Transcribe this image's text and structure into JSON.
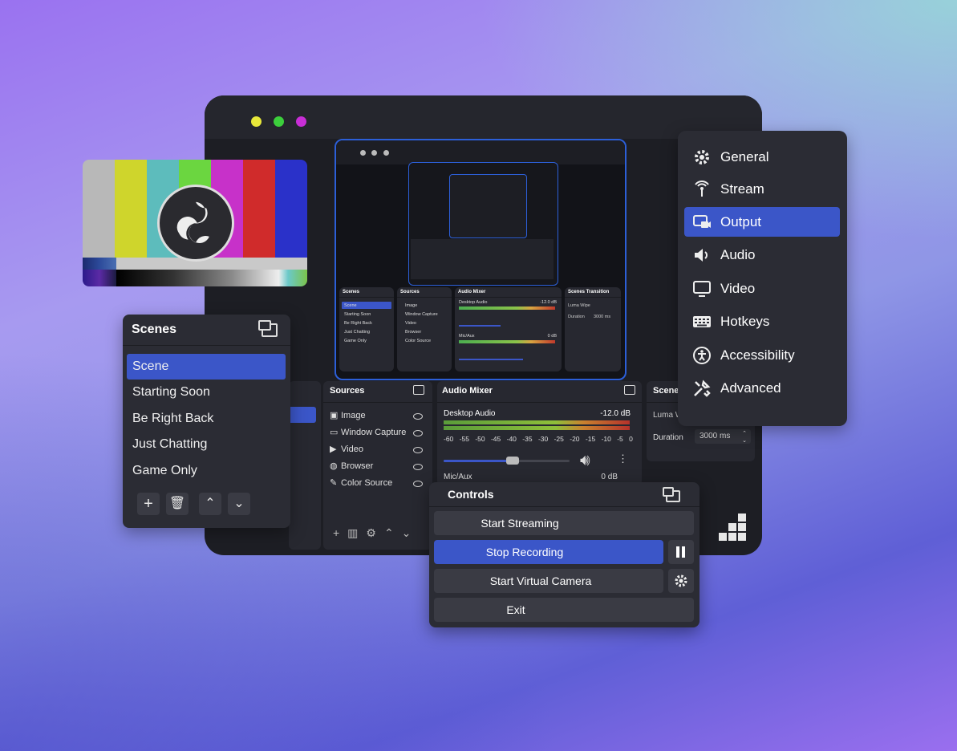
{
  "colors": {
    "accent": "#3b56c8",
    "panel": "#2b2c34",
    "window": "#1d1e24",
    "traffic": [
      "#e8e83a",
      "#3ccf3c",
      "#c82ed6"
    ]
  },
  "scenes_panel": {
    "title": "Scenes",
    "items": [
      "Scene",
      "Starting Soon",
      "Be Right Back",
      "Just Chatting",
      "Game Only"
    ],
    "selected_index": 0
  },
  "settings_menu": {
    "items": [
      {
        "label": "General",
        "icon": "gear-icon"
      },
      {
        "label": "Stream",
        "icon": "broadcast-icon"
      },
      {
        "label": "Output",
        "icon": "output-icon"
      },
      {
        "label": "Audio",
        "icon": "speaker-icon"
      },
      {
        "label": "Video",
        "icon": "monitor-icon"
      },
      {
        "label": "Hotkeys",
        "icon": "keyboard-icon"
      },
      {
        "label": "Accessibility",
        "icon": "accessibility-icon"
      },
      {
        "label": "Advanced",
        "icon": "tools-icon"
      }
    ],
    "selected_index": 2
  },
  "sources_panel": {
    "title": "Sources",
    "items": [
      "Image",
      "Window Capture",
      "Video",
      "Browser",
      "Color Source"
    ]
  },
  "audio_mixer": {
    "title": "Audio Mixer",
    "channels": [
      {
        "name": "Desktop Audio",
        "level": "-12.0 dB",
        "volume": 0.55
      },
      {
        "name": "Mic/Aux",
        "level": "0 dB"
      }
    ],
    "scale": [
      "-60",
      "-55",
      "-50",
      "-45",
      "-40",
      "-35",
      "-30",
      "-25",
      "-20",
      "-15",
      "-10",
      "-5",
      "0"
    ]
  },
  "transitions": {
    "title": "Scene",
    "mode_partial": "Luma W",
    "duration_label": "Duration",
    "duration_value": "3000 ms"
  },
  "controls": {
    "title": "Controls",
    "start_streaming": "Start Streaming",
    "stop_recording": "Stop Recording",
    "start_virtual_camera": "Start Virtual Camera",
    "exit": "Exit"
  },
  "preview_mini": {
    "scenes_title": "Scenes",
    "sources_title": "Sources",
    "mixer_title": "Audio Mixer",
    "transition_title": "Scenes Transition",
    "scenes": [
      "Scene",
      "Starting Soon",
      "Be Right Back",
      "Just Chatting",
      "Game Only"
    ],
    "sources": [
      "Image",
      "Window Capture",
      "Video",
      "Browser",
      "Color Source"
    ],
    "desktop_audio": "Desktop Audio",
    "desktop_level": "-12.0 dB",
    "mic": "Mic/Aux",
    "mic_level": "0 dB",
    "luma": "Luma Wipe",
    "duration": "Duration",
    "duration_value": "3000 ms"
  }
}
